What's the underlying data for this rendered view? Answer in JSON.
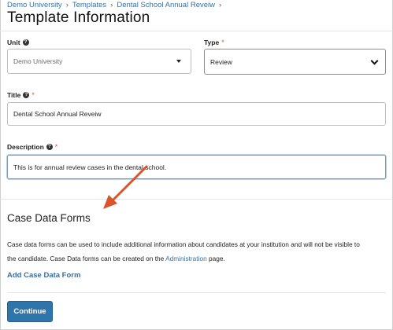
{
  "breadcrumb": [
    "Demo University",
    "Templates",
    "Dental School Annual Reveiw"
  ],
  "breadcrumb_separator": "›",
  "page_title": "Template Information",
  "unit": {
    "label": "Unit",
    "value": "Demo University"
  },
  "type": {
    "label": "Type",
    "required_mark": "*",
    "value": "Review"
  },
  "title_field": {
    "label": "Title",
    "required_mark": "*",
    "value": "Dental School Annual Reveiw"
  },
  "description_field": {
    "label": "Description",
    "required_mark": "*",
    "value": "This is for annual review cases in the dental school."
  },
  "help_glyph": "?",
  "case_data": {
    "heading": "Case Data Forms",
    "line1": "Case data forms can be used to include additional information about candidates at your institution and will not be visible to",
    "line2_pre": "the candidate. Case Data forms can be created on the ",
    "line2_link": "Administration",
    "line2_post": " page.",
    "add_link": "Add Case Data Form"
  },
  "continue_label": "Continue",
  "colors": {
    "accent": "#2e75ab",
    "link": "#3a6f9e",
    "annotation_arrow": "#d9542b",
    "required": "#d9534f"
  },
  "icons": {
    "help": "question-circle-icon",
    "unit_select": "caret-down-icon",
    "type_select": "chevron-down-icon"
  }
}
